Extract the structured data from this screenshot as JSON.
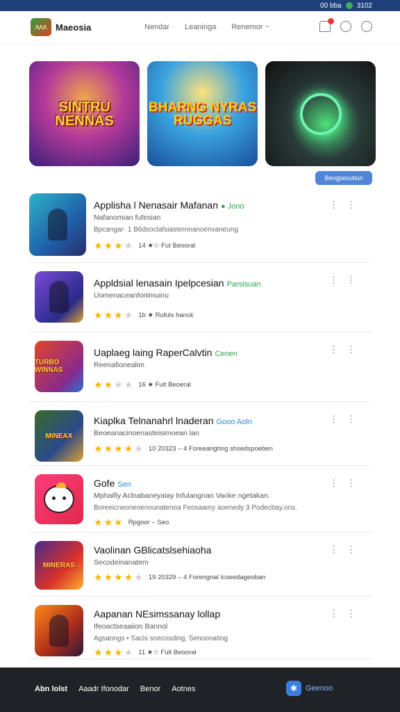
{
  "status": {
    "time": "3102",
    "network": "00 bba"
  },
  "header": {
    "logo_text": "ᐱᐱᐱ",
    "brand": "Maeosia",
    "nav": [
      "Nendar",
      "Leaninga",
      "Renemor ~"
    ]
  },
  "banners": [
    {
      "title": "SINTRU NENNAS"
    },
    {
      "title": "BHARNG NYRAS RUGGAS"
    },
    {
      "title": ""
    }
  ],
  "promo_button": "Bengpesutiun",
  "apps": [
    {
      "name": "Applisha l Nenasair Mafanan",
      "tag": "● Jono",
      "tag_color": "#2aa84a",
      "sub": "Nafanomian fufesian",
      "desc": "Bpcangar· 1 B6dsoclafsiasternnanoenvaneung",
      "rating": 3,
      "stars": 4,
      "meta": "14  ★☆ Fut  Beooral"
    },
    {
      "name": "Appldsial lenasain Ipelpcesian",
      "tag": "Parsisuan",
      "tag_color": "#2aa84a",
      "sub": "Uomenaceanforiimuinu",
      "desc": "",
      "rating": 3,
      "stars": 4,
      "meta": "1b  ★ Rufuls  hanck"
    },
    {
      "name": "Uaplaeg laing RaperCalvtin",
      "tag": "Cenen",
      "tag_color": "#2aa84a",
      "sub": "Reenafionealim",
      "desc": "",
      "rating": 2,
      "stars": 4,
      "meta": "16  ★ Fult  Beoeral"
    },
    {
      "name": "Kiaplka Telnanahrl lnaderan",
      "tag": "Gooo Aoln",
      "tag_color": "#2a8ad8",
      "sub": "Beoeanacinoenasteisimoean lan",
      "desc": "",
      "rating": 4,
      "stars": 5,
      "meta": "10  20323  –  4  Foreeanghng shsedspoeben"
    },
    {
      "name": "Gofe",
      "tag": "Sen",
      "tag_color": "#2a8ad8",
      "sub": "Mphaifiy Aclnabaneyalay lnfulangnan Vaoke ngetakan.",
      "desc": "Boreeicneorieoenounatenoa Feosaamy aoenedy 3 Podecbay.ons.",
      "rating": 3,
      "stars": 3,
      "meta": "Rpgoor – Seo"
    },
    {
      "name": "Vaolinan GBlicatslsehiaoha",
      "tag": "",
      "tag_color": "#2aa84a",
      "sub": "Secodeinanatem",
      "desc": "",
      "rating": 4,
      "stars": 5,
      "meta": "19  20329  –  4  Forengnal lcoeedageoban"
    },
    {
      "name": "Aapanan NEsimssanay lollap",
      "tag": "",
      "tag_color": "#2aa84a",
      "sub": "Ifeoactseaaiion Bannol",
      "desc": "Agsanngs • Sacis snecosding, Senoonating",
      "rating": 3,
      "stars": 4,
      "meta": "11  ★☆ Fult  Beooral"
    }
  ],
  "footer": {
    "links": [
      "Abn lolst",
      "Aaadr Ifonodar",
      "Benor",
      "Aotnes"
    ],
    "chat_label": "Geenoo"
  },
  "colors": {
    "accent": "#4f86d8",
    "star": "#f5b800",
    "status_bar": "#1e3f7a",
    "footer": "#1f2226"
  }
}
